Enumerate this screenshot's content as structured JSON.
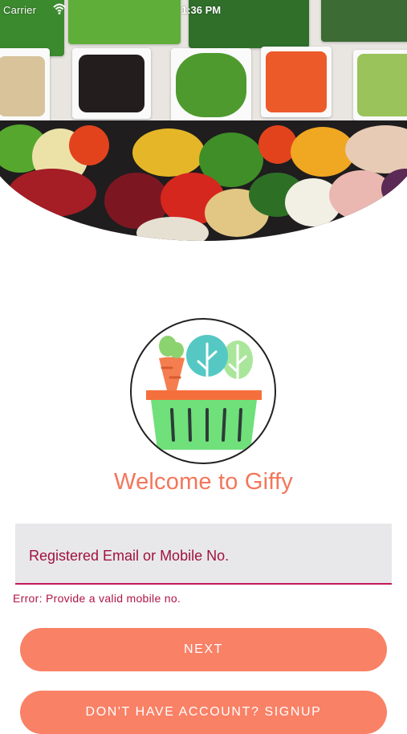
{
  "status_bar": {
    "carrier": "Carrier",
    "time": "1:36 PM"
  },
  "hero": {
    "image": "vegetable-tray-photo"
  },
  "logo": {
    "icon": "vegetable-basket-icon"
  },
  "welcome_text": "Welcome to Giffy",
  "login_field": {
    "placeholder": "Registered Email or Mobile No.",
    "value": ""
  },
  "error_text": "Error: Provide a valid mobile no.",
  "buttons": {
    "next_label": "NEXT",
    "signup_label": "DON'T HAVE ACCOUNT? SIGNUP"
  },
  "colors": {
    "accent": "#f98166",
    "welcome": "#f3765a",
    "error": "#b01545",
    "field_bg": "#e8e8ea"
  }
}
